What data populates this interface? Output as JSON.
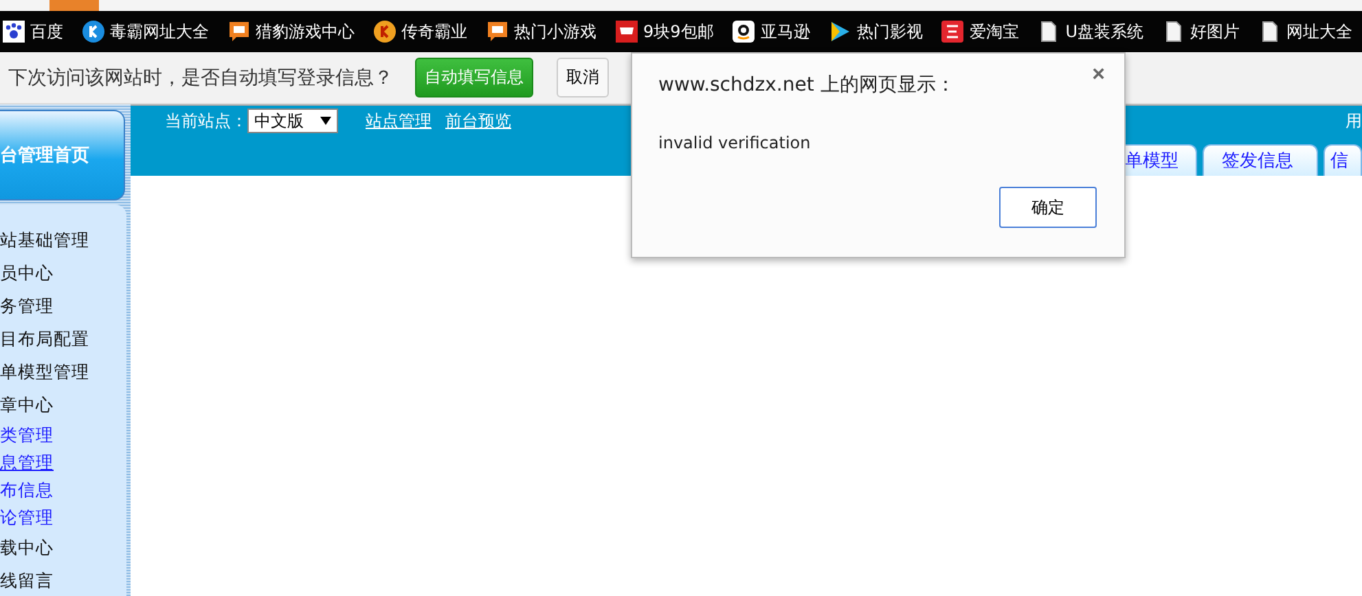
{
  "bookmarks": [
    {
      "label": "百度",
      "kind": "paw"
    },
    {
      "label": "毒霸网址大全",
      "kind": "k"
    },
    {
      "label": "猎豹游戏中心",
      "kind": "box"
    },
    {
      "label": "传奇霸业",
      "kind": "coin"
    },
    {
      "label": "热门小游戏",
      "kind": "box"
    },
    {
      "label": "9块9包邮",
      "kind": "cart"
    },
    {
      "label": "亚马逊",
      "kind": "a"
    },
    {
      "label": "热门影视",
      "kind": "play"
    },
    {
      "label": "爱淘宝",
      "kind": "tao"
    },
    {
      "label": "U盘装系统",
      "kind": "page"
    },
    {
      "label": "好图片",
      "kind": "page"
    },
    {
      "label": "网址大全",
      "kind": "page"
    }
  ],
  "password_bar": {
    "message": "下次访问该网站时，是否自动填写登录信息？",
    "accept": "自动填写信息",
    "cancel": "取消"
  },
  "sidebar": {
    "home": "台管理首页",
    "items": [
      {
        "label": "站基础管理",
        "kind": "section"
      },
      {
        "label": "员中心",
        "kind": "section"
      },
      {
        "label": "务管理",
        "kind": "section"
      },
      {
        "label": "目布局配置",
        "kind": "section"
      },
      {
        "label": "单模型管理",
        "kind": "section"
      },
      {
        "label": "章中心",
        "kind": "section"
      },
      {
        "label": "类管理",
        "kind": "link",
        "selected": false
      },
      {
        "label": "息管理",
        "kind": "link",
        "selected": true
      },
      {
        "label": "布信息",
        "kind": "link",
        "selected": false
      },
      {
        "label": "论管理",
        "kind": "link",
        "selected": false
      },
      {
        "label": "载中心",
        "kind": "section"
      },
      {
        "label": "线留言",
        "kind": "section"
      }
    ]
  },
  "header": {
    "site_label": "当前站点：",
    "site_select": "中文版",
    "links": [
      "站点管理",
      "前台预览"
    ],
    "user": "用"
  },
  "tabs": [
    {
      "label": "单模型"
    },
    {
      "label": "签发信息"
    },
    {
      "label": "信"
    }
  ],
  "dialog": {
    "title": "www.schdzx.net 上的网页显示：",
    "message": "invalid verification",
    "ok": "确定",
    "close": "×"
  }
}
